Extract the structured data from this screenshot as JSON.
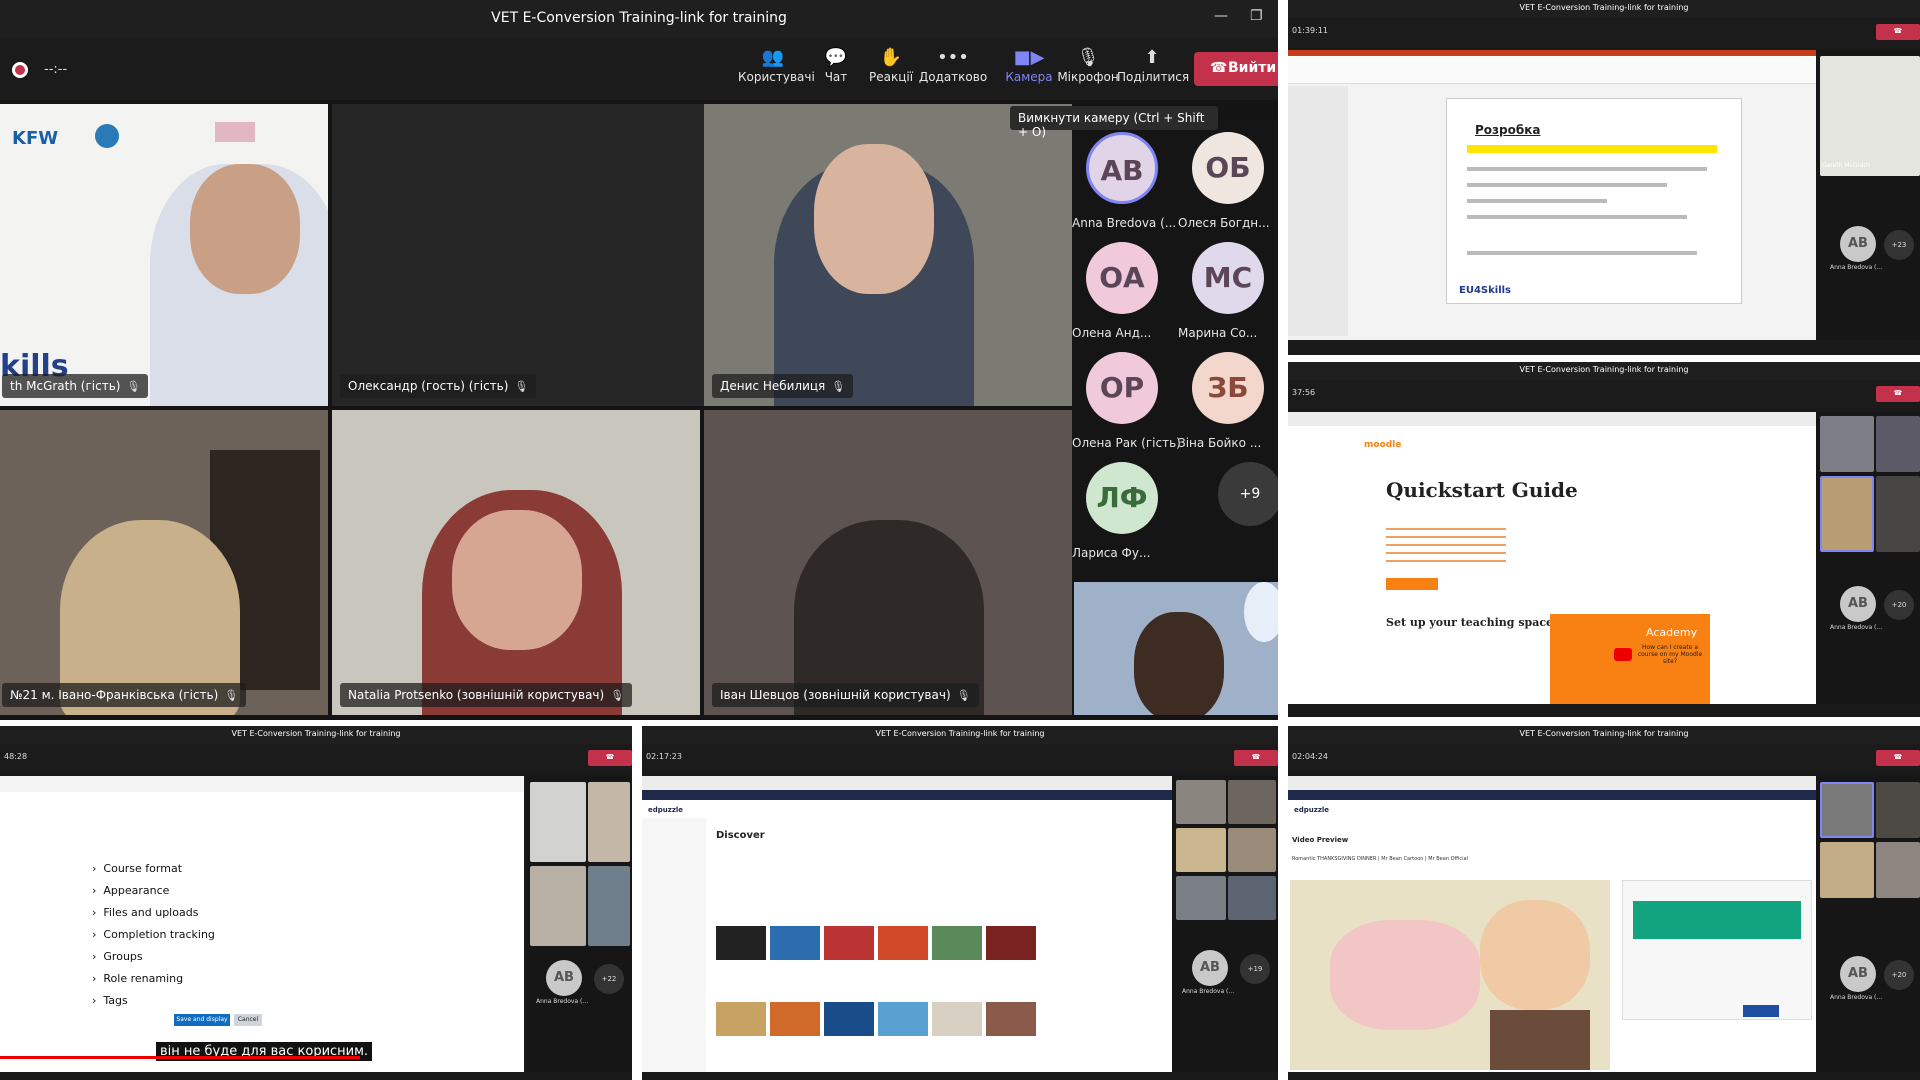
{
  "main": {
    "title": "VET E-Conversion Training-link for training",
    "timer": "--:--",
    "toolbar": {
      "people": "Користувачі",
      "chat": "Чат",
      "reactions": "Реакції",
      "more": "Додатково",
      "camera": "Камера",
      "mic": "Мікрофон",
      "share": "Поділитися",
      "leave": "Вийти"
    },
    "tooltip": "Вимкнути камеру (Ctrl + Shift + O)",
    "tiles": [
      {
        "name": "th McGrath (гість)"
      },
      {
        "name": "Олександр (гость) (гість)"
      },
      {
        "name": "Денис Небилиця"
      },
      {
        "name": "№21 м. Івано-Франківська (гість)"
      },
      {
        "name": "Natalia Protsenko (зовнішній користувач)"
      },
      {
        "name": "Іван Шевцов (зовнішній користувач)"
      }
    ],
    "logo_texts": {
      "kfw": "KFW",
      "skills": "kills"
    },
    "avatars": [
      {
        "initials": "АВ",
        "name": "Anna Bredova (..."
      },
      {
        "initials": "ОБ",
        "name": "Олеся Богдн..."
      },
      {
        "initials": "ОА",
        "name": "Олена Анд..."
      },
      {
        "initials": "МС",
        "name": "Марина Со..."
      },
      {
        "initials": "ОР",
        "name": "Олена Рак (гість)"
      },
      {
        "initials": "ЗБ",
        "name": "Зіна Бойко ..."
      },
      {
        "initials": "ЛФ",
        "name": "Лариса Фу..."
      }
    ],
    "more_count": "+9"
  },
  "panels": {
    "p1": {
      "title": "VET E-Conversion Training-link for training",
      "time": "01:39:11",
      "slide_title": "Розробка",
      "slide_brand": "EU4Skills",
      "avatar": "AB",
      "caption": "Anna Bredova (...",
      "more": "+23",
      "host": "Gareth McGrath"
    },
    "p2": {
      "title": "VET E-Conversion Training-link for training",
      "time": "37:56",
      "site": "moodle",
      "heading": "Quickstart Guide",
      "sub": "Set up your teaching space",
      "video_title": "Academy",
      "video_text": "How can I create a course on my Moodle site?",
      "avatar": "AB",
      "caption": "Anna Bredova (...",
      "more": "+20"
    },
    "p3": {
      "title": "VET E-Conversion Training-link for training",
      "time": "48:28",
      "items": [
        "Course format",
        "Appearance",
        "Files and uploads",
        "Completion tracking",
        "Groups",
        "Role renaming",
        "Tags"
      ],
      "subtitle": "він не буде для вас корисним.",
      "save": "Save and display",
      "cancel": "Cancel",
      "avatar": "AB",
      "caption": "Anna Bredova (...",
      "more": "+22"
    },
    "p4": {
      "title": "VET E-Conversion Training-link for training",
      "time": "02:17:23",
      "site": "edpuzzle",
      "heading": "Discover",
      "avatar": "AB",
      "caption": "Anna Bredova (...",
      "more": "+19"
    },
    "p5": {
      "title": "VET E-Conversion Training-link for training",
      "time": "02:04:24",
      "site": "edpuzzle",
      "heading": "Video Preview",
      "video_title": "Romantic THANKSGIVING DINNER | Mr Bean Cartoon | Mr Bean Official",
      "avatar": "AB",
      "caption": "Anna Bredova (...",
      "more": "+20"
    }
  },
  "colors": {
    "leave": "#c4314b",
    "accent": "#7f85f5",
    "avatar_bg": "#f0c9da"
  }
}
